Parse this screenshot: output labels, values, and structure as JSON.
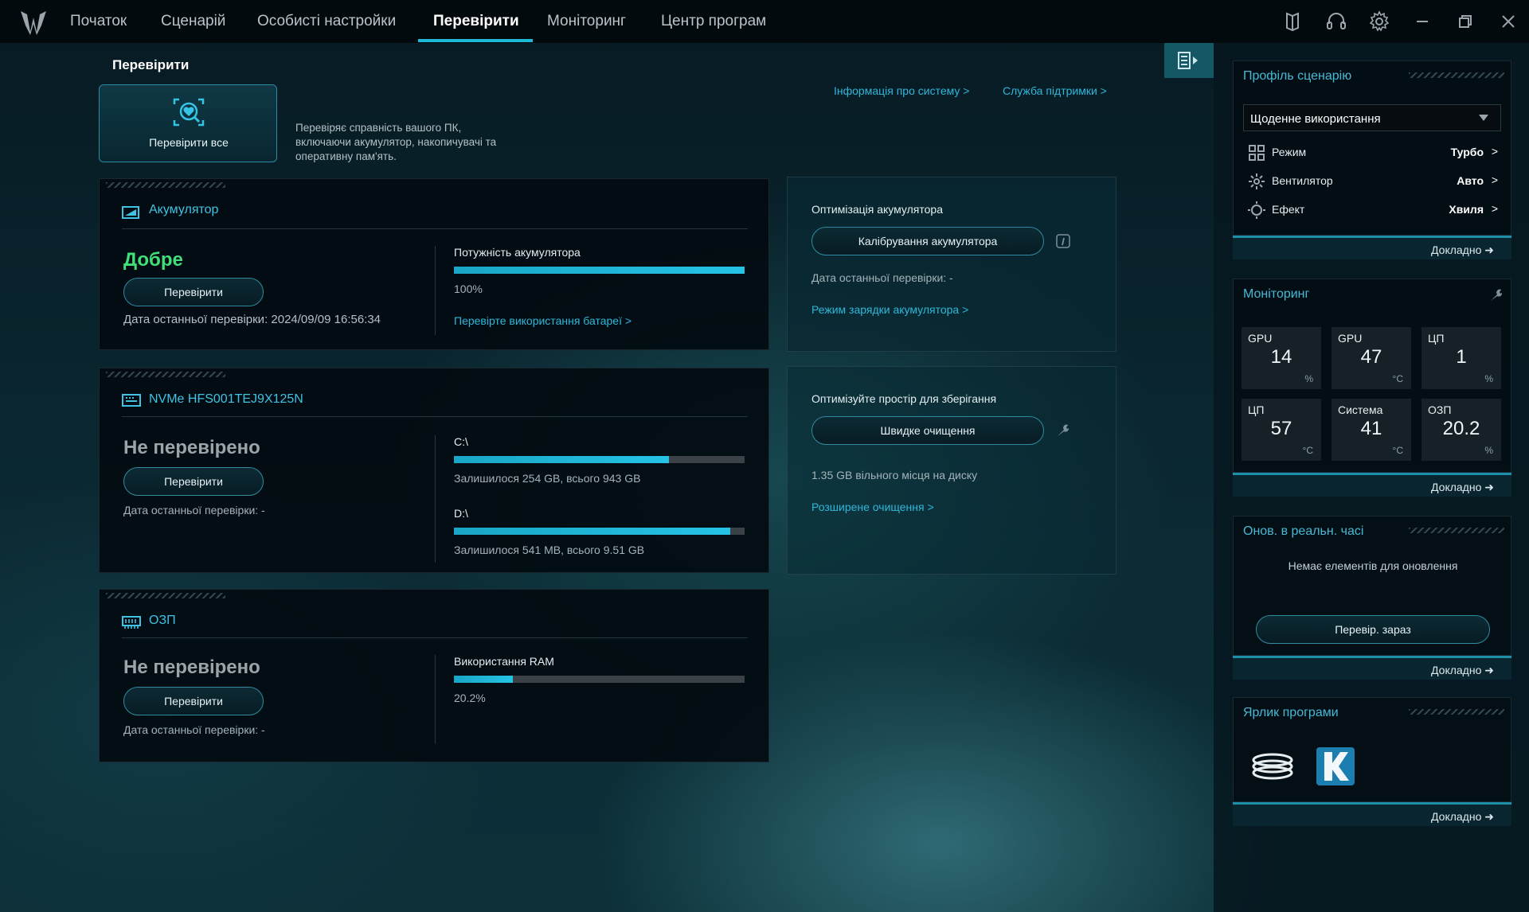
{
  "nav": {
    "items": [
      "Початок",
      "Сценарій",
      "Особисті настройки",
      "Перевірити",
      "Моніторинг",
      "Центр програм"
    ],
    "active": "Перевірити"
  },
  "page": {
    "title": "Перевірити",
    "check_all_label": "Перевірити все",
    "check_all_desc": [
      "Перевіряє справність вашого ПК,",
      "включаючи акумулятор, накопичувачі та",
      "оперативну пам'ять."
    ],
    "system_info_link": "Інформація про систему >",
    "support_link": "Служба підтримки >"
  },
  "battery": {
    "title": "Акумулятор",
    "status": "Добре",
    "status_color": "#3fe07a",
    "check_label": "Перевірити",
    "last_check": "Дата останньої перевірки: 2024/09/09 16:56:34",
    "power_label": "Потужність акумулятора",
    "power_value": "100%",
    "power_fraction": 1.0,
    "usage_link": "Перевірте використання батареї >"
  },
  "battery_opt": {
    "title": "Оптимізація акумулятора",
    "calibrate_label": "Калібрування акумулятора",
    "last_check": "Дата останньої перевірки: -",
    "charge_mode_link": "Режим зарядки акумулятора >"
  },
  "storage": {
    "title": "NVMe HFS001TEJ9X125N",
    "status": "Не перевірено",
    "check_label": "Перевірити",
    "last_check": "Дата останньої перевірки: -",
    "drives": [
      {
        "name": "C:\\",
        "info": "Залишилося 254 GB, всього 943 GB",
        "used_fraction": 0.74
      },
      {
        "name": "D:\\",
        "info": "Залишилося 541 MB, всього 9.51 GB",
        "used_fraction": 0.95
      }
    ]
  },
  "storage_opt": {
    "title": "Оптимізуйте простір для зберігання",
    "quick_clean_label": "Швидке очищення",
    "free_space": "1.35 GB вільного місця на диску",
    "advanced_link": "Розширене очищення >"
  },
  "ram": {
    "title": "ОЗП",
    "status": "Не перевірено",
    "check_label": "Перевірити",
    "last_check": "Дата останньої перевірки: -",
    "usage_label": "Використання RAM",
    "usage_value": "20.2%",
    "usage_fraction": 0.202
  },
  "profile": {
    "title": "Профіль сценарію",
    "selected": "Щоденне використання",
    "rows": [
      {
        "label": "Режим",
        "value": "Турбо",
        "icon": "grid-icon"
      },
      {
        "label": "Вентилятор",
        "value": "Авто",
        "icon": "fan-icon"
      },
      {
        "label": "Ефект",
        "value": "Хвиля",
        "icon": "sun-icon"
      }
    ],
    "more": "Докладно"
  },
  "monitoring": {
    "title": "Моніторинг",
    "tiles": [
      {
        "label": "GPU",
        "value": "14",
        "unit": "%"
      },
      {
        "label": "GPU",
        "value": "47",
        "unit": "°C"
      },
      {
        "label": "ЦП",
        "value": "1",
        "unit": "%"
      },
      {
        "label": "ЦП",
        "value": "57",
        "unit": "°C"
      },
      {
        "label": "Система",
        "value": "41",
        "unit": "°C"
      },
      {
        "label": "ОЗП",
        "value": "20.2",
        "unit": "%"
      }
    ],
    "more": "Докладно"
  },
  "updates": {
    "title": "Онов. в реальн. часі",
    "empty_text": "Немає елементів для оновлення",
    "check_now": "Перевір. зараз",
    "more": "Докладно"
  },
  "shortcuts": {
    "title": "Ярлик програми",
    "apps": [
      "coil-app-icon",
      "k-app-icon"
    ],
    "more": "Докладно"
  },
  "colors": {
    "accent": "#1fb9d8",
    "good": "#3fe07a"
  }
}
